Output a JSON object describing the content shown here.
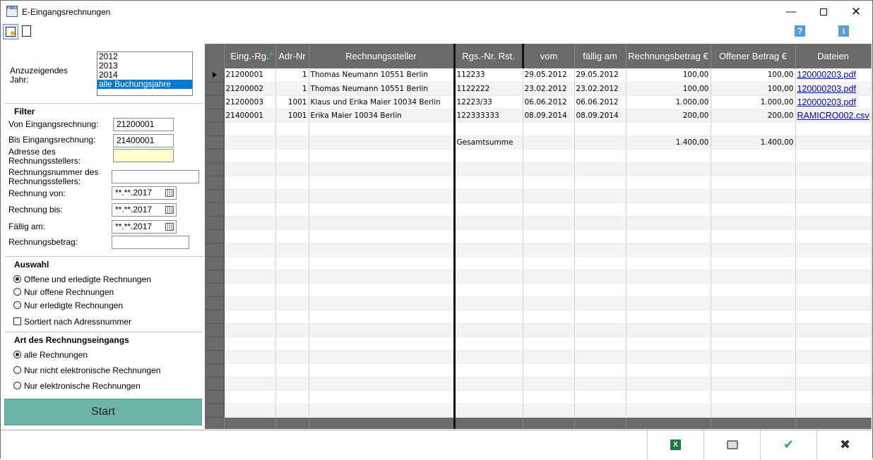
{
  "window": {
    "title": "E-Eingangsrechnungen"
  },
  "toolbar": {
    "help": "?",
    "info": "i"
  },
  "filter_panel": {
    "year_label": "Anzuzeigendes Jahr:",
    "years": [
      "2012",
      "2013",
      "2014",
      "alle Buchungsjahre"
    ],
    "selected_year": "alle Buchungsjahre",
    "filter_heading": "Filter",
    "von_label": "Von Eingangsrechnung:",
    "von_value": "21200001",
    "bis_label": "Bis Eingangsrechnung:",
    "bis_value": "21400001",
    "adresse_label": "Adresse des Rechnungsstellers:",
    "adresse_value": "",
    "rgnr_label": "Rechnungsnummer des Rechnungsstellers:",
    "rgnr_value": "",
    "rg_von_label": "Rechnung von:",
    "rg_von_value": "**.**.2017",
    "rg_bis_label": "Rechnung bis:",
    "rg_bis_value": "**.**.2017",
    "faellig_label": "Fällig am:",
    "faellig_value": "**.**.2017",
    "betrag_label": "Rechnungsbetrag:",
    "betrag_value": "",
    "auswahl_heading": "Auswahl",
    "auswahl_options": [
      "Offene und erledigte Rechnungen",
      "Nur offene Rechnungen",
      "Nur erledigte Rechnungen"
    ],
    "auswahl_selected": 0,
    "sortiert_label": "Sortiert nach Adressnummer",
    "sortiert_checked": false,
    "art_heading": "Art des Rechnungseingangs",
    "art_options": [
      "alle Rechnungen",
      "Nur nicht elektronische Rechnungen",
      "Nur elektronische Rechnungen"
    ],
    "art_selected": 0,
    "start_label": "Start"
  },
  "grid": {
    "columns": [
      "Eing.-Rg.",
      "Adr-Nr",
      "Rechnungssteller",
      "Rgs.-Nr. Rst.",
      "vom",
      "fällig am",
      "Rechnungsbetrag €",
      "Offener Betrag €",
      "Dateien"
    ],
    "rows": [
      [
        "21200001",
        "1",
        "Thomas Neumann 10551 Berlin",
        "112233",
        "29.05.2012",
        "29.05.2012",
        "100,00",
        "100,00",
        "120000203.pdf"
      ],
      [
        "21200002",
        "1",
        "Thomas Neumann 10551 Berlin",
        "1122222",
        "23.02.2012",
        "23.02.2012",
        "100,00",
        "100,00",
        "120000203.pdf"
      ],
      [
        "21200003",
        "1001",
        "Klaus und Erika Maier 10034 Berlin",
        "12223/33",
        "06.06.2012",
        "06.06.2012",
        "1.000,00",
        "1.000,00",
        "120000203.pdf"
      ],
      [
        "21400001",
        "1001",
        "Erika Maier 10034 Berlin",
        "122333333",
        "08.09.2014",
        "08.09.2014",
        "200,00",
        "200,00",
        "RAMICRO002.csv"
      ],
      [
        "",
        "",
        "",
        "",
        "",
        "",
        "",
        "",
        ""
      ],
      [
        "",
        "",
        "",
        "Gesamtsumme",
        "",
        "",
        "1.400,00",
        "1.400,00",
        ""
      ]
    ],
    "empty_rows": 20
  },
  "colors": {
    "start_button": "#6cb5a6",
    "grid_header": "#6a6a6a",
    "selection": "#0078d7",
    "link": "#0000cc"
  },
  "bottom_icons": [
    "excel-icon",
    "printer-icon",
    "checkmark-icon",
    "close-icon"
  ]
}
